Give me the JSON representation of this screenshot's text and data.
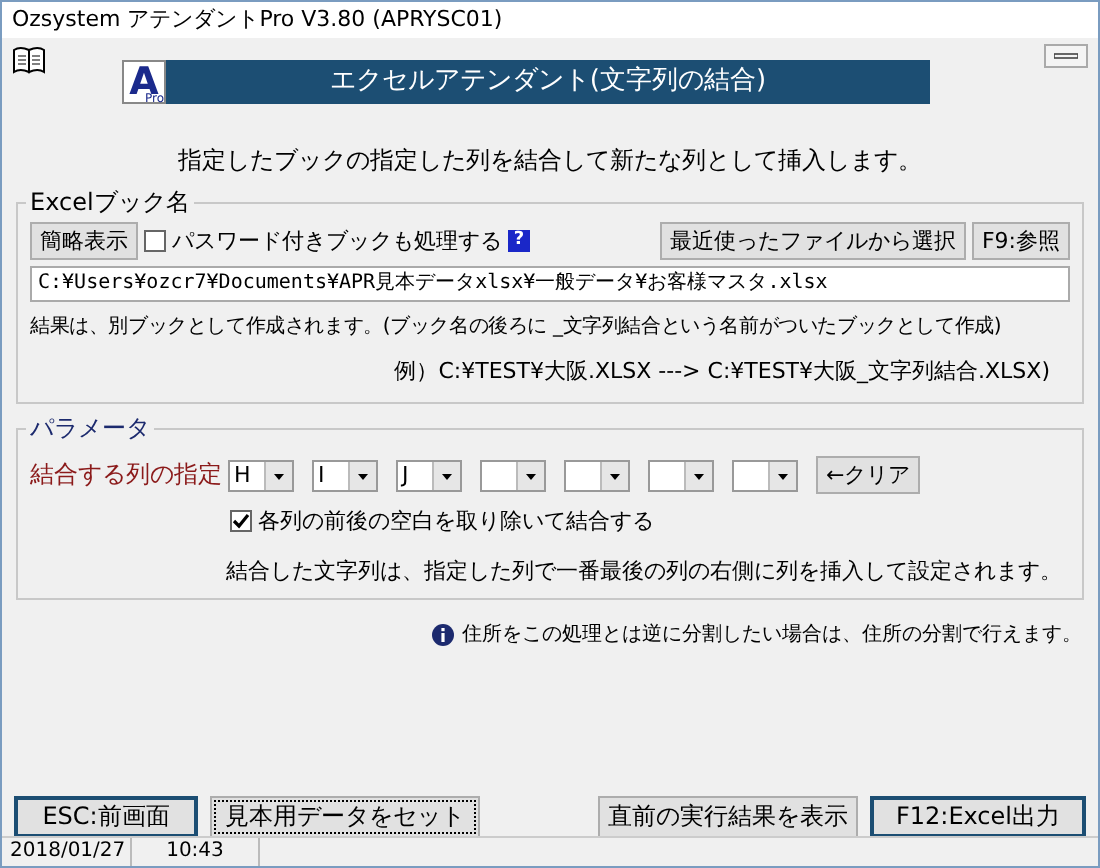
{
  "window": {
    "title": "Ozsystem アテンダントPro V3.80 (APRYSC01)"
  },
  "header": {
    "logo_letter": "A",
    "logo_sub": "Pro",
    "title": "エクセルアテンダント(文字列の結合)"
  },
  "description": "指定したブックの指定した列を結合して新たな列として挿入します。",
  "excel_group": {
    "legend": "Excelブック名",
    "toggle_button": "簡略表示",
    "password_checkbox": {
      "label": "パスワード付きブックも処理する",
      "checked": false
    },
    "help_mark": "?",
    "recent_button": "最近使ったファイルから選択",
    "browse_button": "F9:参照",
    "path": "C:¥Users¥ozcr7¥Documents¥APR見本データxlsx¥一般データ¥お客様マスタ.xlsx",
    "note": "結果は、別ブックとして作成されます。(ブック名の後ろに _文字列結合という名前がついたブックとして作成)",
    "example": "例）C:¥TEST¥大阪.XLSX ---> C:¥TEST¥大阪_文字列結合.XLSX)"
  },
  "parameters": {
    "legend": "パラメータ",
    "columns_label": "結合する列の指定",
    "column_selects": [
      {
        "value": "H"
      },
      {
        "value": "I"
      },
      {
        "value": "J"
      }
    ],
    "clear_button": "←クリア",
    "trim_checkbox": {
      "label": "各列の前後の空白を取り除いて結合する",
      "checked": true
    },
    "note": "結合した文字列は、指定した列で一番最後の列の右側に列を挿入して設定されます。"
  },
  "info": "住所をこの処理とは逆に分割したい場合は、住所の分割で行えます。",
  "buttons": [
    {
      "label": "ESC:前画面",
      "kind": "emphasized"
    },
    {
      "label": "見本用データをセット",
      "kind": "focused"
    },
    {
      "label": "直前の実行結果を表示",
      "kind": "normal"
    },
    {
      "label": "F12:Excel出力",
      "kind": "emphasized"
    }
  ],
  "status_bar": {
    "date": "2018/01/27",
    "time": "10:43"
  }
}
